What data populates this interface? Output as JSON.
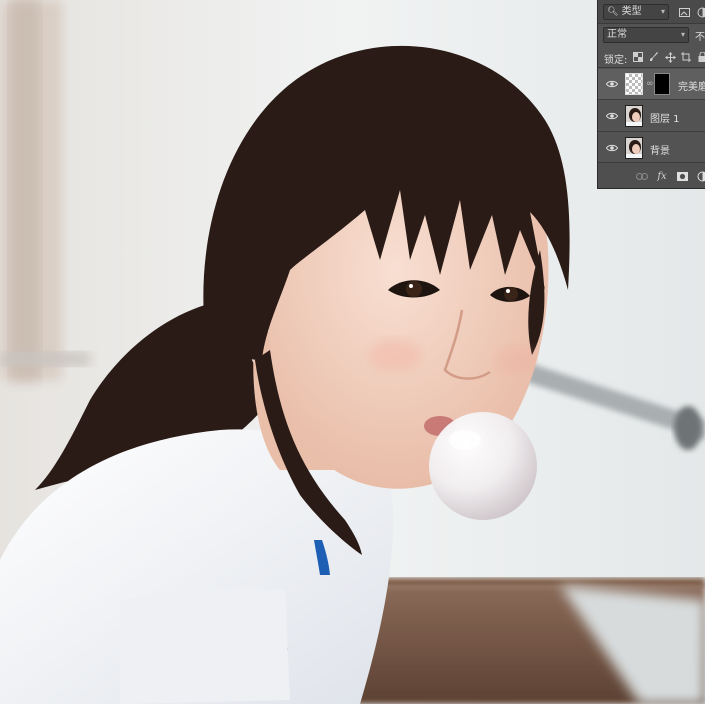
{
  "photo": {
    "description_icon": "photo-canvas"
  },
  "layers_panel": {
    "filter": {
      "search_icon": "search-icon",
      "value": "类型"
    },
    "blend_mode": {
      "value": "正常",
      "opacity_label": "不"
    },
    "lock": {
      "label": "锁定:"
    },
    "layers": [
      {
        "name": "完美磨",
        "visible": true,
        "has_mask": true,
        "selected": true
      },
      {
        "name": "图层 1",
        "visible": true,
        "has_mask": false,
        "selected": false
      },
      {
        "name": "背景",
        "visible": true,
        "has_mask": false,
        "selected": false
      }
    ],
    "footer_icons": [
      "link-icon",
      "fx-icon",
      "mask-icon",
      "adjustment-icon"
    ],
    "fx_label": "fx"
  },
  "colors": {
    "panel_bg": "#535353",
    "skin": "#f3d2c2",
    "hair": "#2a1b16",
    "shirt": "#f6f7f9",
    "shirt_trim": "#1d5fb5"
  }
}
